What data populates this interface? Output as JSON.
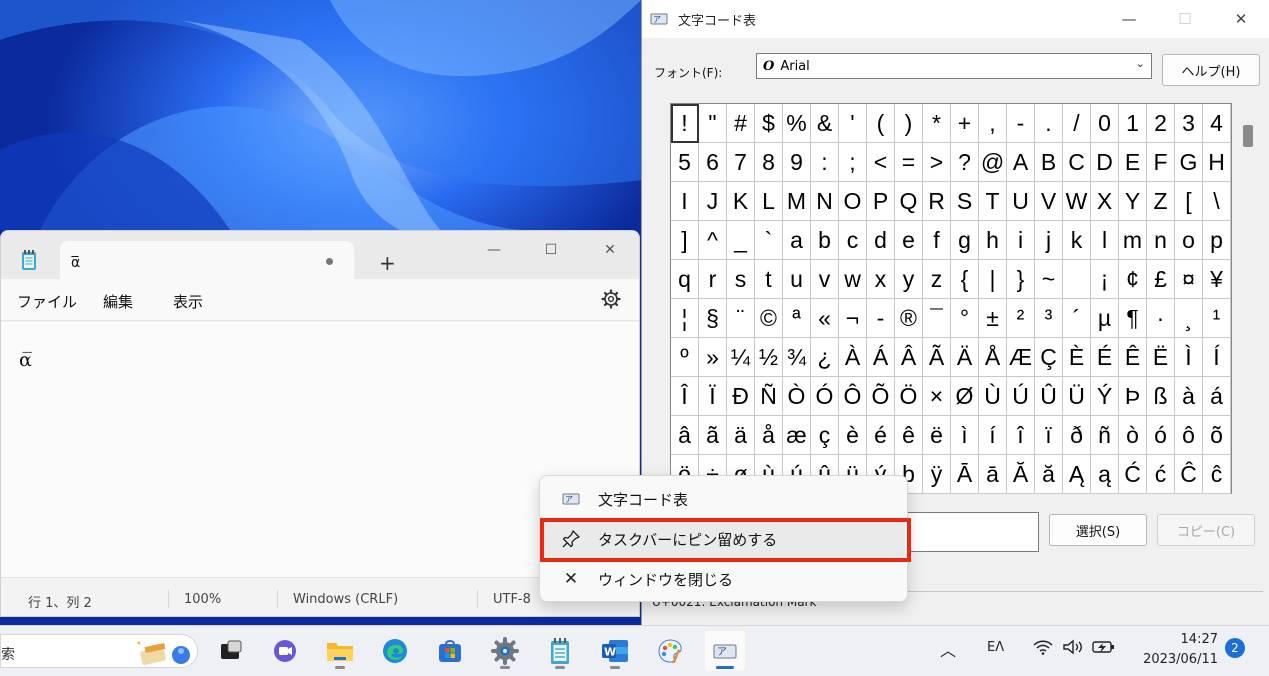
{
  "charmap": {
    "title": "文字コード表",
    "font_label": "フォント(F):",
    "font_value": "Arial",
    "font_icon": "O",
    "help_button": "ヘルプ(H)",
    "select_button": "選択(S)",
    "copy_button": "コピー(C)",
    "status_text": "U+0021: Exclamation Mark",
    "characters": [
      [
        "!",
        "\"",
        "#",
        "$",
        "%",
        "&",
        "'",
        "(",
        ")",
        "*",
        "+",
        ",",
        "-",
        ".",
        "/",
        "0",
        "1",
        "2",
        "3",
        "4"
      ],
      [
        "5",
        "6",
        "7",
        "8",
        "9",
        ":",
        ";",
        "<",
        "=",
        ">",
        "?",
        "@",
        "A",
        "B",
        "C",
        "D",
        "E",
        "F",
        "G",
        "H"
      ],
      [
        "I",
        "J",
        "K",
        "L",
        "M",
        "N",
        "O",
        "P",
        "Q",
        "R",
        "S",
        "T",
        "U",
        "V",
        "W",
        "X",
        "Y",
        "Z",
        "[",
        "\\"
      ],
      [
        "]",
        "^",
        "_",
        "`",
        "a",
        "b",
        "c",
        "d",
        "e",
        "f",
        "g",
        "h",
        "i",
        "j",
        "k",
        "l",
        "m",
        "n",
        "o",
        "p"
      ],
      [
        "q",
        "r",
        "s",
        "t",
        "u",
        "v",
        "w",
        "x",
        "y",
        "z",
        "{",
        "|",
        "}",
        "~",
        "",
        "¡",
        "¢",
        "£",
        "¤",
        "¥"
      ],
      [
        "¦",
        "§",
        "¨",
        "©",
        "ª",
        "«",
        "¬",
        "-",
        "®",
        "¯",
        "°",
        "±",
        "²",
        "³",
        "´",
        "µ",
        "¶",
        "·",
        "¸",
        "¹"
      ],
      [
        "º",
        "»",
        "¼",
        "½",
        "¾",
        "¿",
        "À",
        "Á",
        "Â",
        "Ã",
        "Ä",
        "Å",
        "Æ",
        "Ç",
        "È",
        "É",
        "Ê",
        "Ë",
        "Ì",
        "Í"
      ],
      [
        "Î",
        "Ï",
        "Ð",
        "Ñ",
        "Ò",
        "Ó",
        "Ô",
        "Õ",
        "Ö",
        "×",
        "Ø",
        "Ù",
        "Ú",
        "Û",
        "Ü",
        "Ý",
        "Þ",
        "ß",
        "à",
        "á"
      ],
      [
        "â",
        "ã",
        "ä",
        "å",
        "æ",
        "ç",
        "è",
        "é",
        "ê",
        "ë",
        "ì",
        "í",
        "î",
        "ï",
        "ð",
        "ñ",
        "ò",
        "ó",
        "ô",
        "õ"
      ],
      [
        "ö",
        "÷",
        "ø",
        "ù",
        "ú",
        "û",
        "ü",
        "ý",
        "þ",
        "ÿ",
        "Ā",
        "ā",
        "Ă",
        "ă",
        "Ą",
        "ą",
        "Ć",
        "ć",
        "Ĉ",
        "ĉ"
      ]
    ]
  },
  "notepad": {
    "tab_title": "α̅",
    "menu": [
      "ファイル",
      "編集",
      "表示"
    ],
    "content": "α̅",
    "status": {
      "position": "行 1、列 2",
      "zoom": "100%",
      "line_ending": "Windows (CRLF)",
      "encoding": "UTF-8"
    }
  },
  "context_menu": {
    "items": [
      {
        "label": "文字コード表",
        "icon": "charmap-app-icon"
      },
      {
        "label": "タスクバーにピン留めする",
        "icon": "pin-icon"
      },
      {
        "label": "ウィンドウを閉じる",
        "icon": "close-icon"
      }
    ]
  },
  "taskbar": {
    "search_text": "索",
    "ime": "EΛ",
    "time": "14:27",
    "date": "2023/06/11",
    "notification_count": "2",
    "apps": [
      "task-view-icon",
      "teams-chat-icon",
      "file-explorer-icon",
      "edge-icon",
      "store-icon",
      "settings-icon",
      "notepad-icon",
      "word-icon",
      "paint-icon",
      "charmap-icon"
    ]
  },
  "colors": {
    "highlight_box": "#ea2a10",
    "accent": "#1a6fd8"
  }
}
